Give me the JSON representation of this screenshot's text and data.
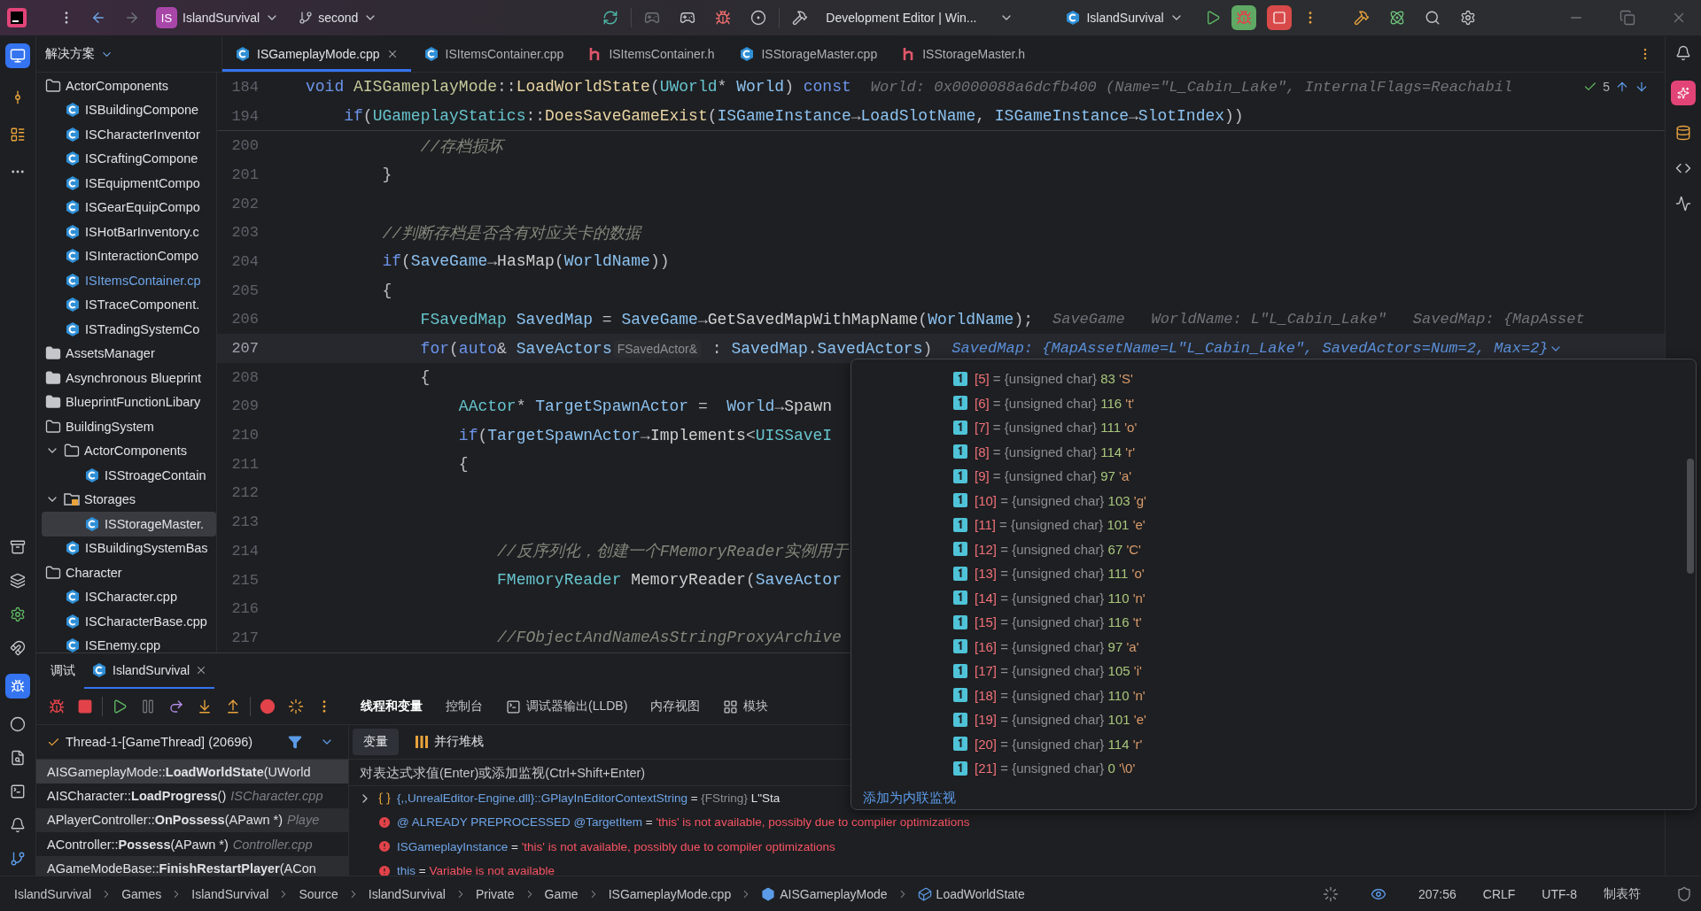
{
  "toolbar": {
    "project_badge": "IS",
    "project": "IslandSurvival",
    "branch": "second",
    "build_config": "Development Editor | Win...",
    "run_config": "IslandSurvival"
  },
  "explorer": {
    "title": "解决方案"
  },
  "editor_tabs": [
    {
      "label": "ISGameplayMode.cpp",
      "kind": "cpp",
      "selected": true
    },
    {
      "label": "ISItemsContainer.cpp",
      "kind": "cpp",
      "selected": false
    },
    {
      "label": "ISItemsContainer.h",
      "kind": "header",
      "selected": false
    },
    {
      "label": "ISStorageMaster.cpp",
      "kind": "cpp",
      "selected": false
    },
    {
      "label": "ISStorageMaster.h",
      "kind": "header",
      "selected": false
    }
  ],
  "tree": [
    {
      "label": "ActorComponents",
      "kind": "folder",
      "expanded": true,
      "selected": false,
      "children": [
        {
          "label": "ISBuildingCompone",
          "kind": "file",
          "selected": false,
          "modified": false
        },
        {
          "label": "ISCharacterInventor",
          "kind": "file",
          "selected": false,
          "modified": false
        },
        {
          "label": "ISCraftingCompone",
          "kind": "file",
          "selected": false,
          "modified": false
        },
        {
          "label": "ISEquipmentCompo",
          "kind": "file",
          "selected": false,
          "modified": false
        },
        {
          "label": "ISGearEquipCompo",
          "kind": "file",
          "selected": false,
          "modified": false
        },
        {
          "label": "ISHotBarInventory.c",
          "kind": "file",
          "selected": false,
          "modified": false
        },
        {
          "label": "ISInteractionCompo",
          "kind": "file",
          "selected": false,
          "modified": false
        },
        {
          "label": "ISItemsContainer.cp",
          "kind": "file",
          "selected": false,
          "modified": true
        },
        {
          "label": "ISTraceComponent.",
          "kind": "file",
          "selected": false,
          "modified": false
        },
        {
          "label": "ISTradingSystemCo",
          "kind": "file",
          "selected": false,
          "modified": false
        }
      ]
    },
    {
      "label": "AssetsManager",
      "kind": "folder",
      "expanded": false,
      "selected": false
    },
    {
      "label": "Asynchronous Blueprint",
      "kind": "folder",
      "expanded": false,
      "selected": false
    },
    {
      "label": "BlueprintFunctionLibary",
      "kind": "folder",
      "expanded": false,
      "selected": false
    },
    {
      "label": "BuildingSystem",
      "kind": "folder",
      "expanded": true,
      "selected": false,
      "children": [
        {
          "label": "ActorComponents",
          "kind": "folder",
          "expanded": true,
          "selected": false,
          "children": [
            {
              "label": "ISStroageContain",
              "kind": "file",
              "selected": false,
              "modified": false
            }
          ]
        },
        {
          "label": "Storages",
          "kind": "package",
          "expanded": true,
          "selected": false,
          "children": [
            {
              "label": "ISStorageMaster.",
              "kind": "file",
              "selected": true,
              "modified": false
            }
          ]
        },
        {
          "label": "ISBuildingSystemBas",
          "kind": "file",
          "selected": false,
          "modified": false
        }
      ]
    },
    {
      "label": "Character",
      "kind": "folder",
      "expanded": true,
      "selected": false,
      "children": [
        {
          "label": "ISCharacter.cpp",
          "kind": "file",
          "selected": false,
          "modified": false
        },
        {
          "label": "ISCharacterBase.cpp",
          "kind": "file",
          "selected": false,
          "modified": false
        },
        {
          "label": "ISEnemy.cpp",
          "kind": "file",
          "selected": false,
          "modified": false
        }
      ]
    }
  ],
  "editor": {
    "inspection_count": "5",
    "sticky_lines": [
      {
        "number": "184",
        "current": false,
        "tokens": [
          {
            "kind": "kw",
            "text": "void"
          },
          {
            "kind": "cls",
            "text": " AISGameplayMode"
          },
          {
            "kind": "p",
            "text": "::"
          },
          {
            "kind": "fn",
            "text": "LoadWorldState"
          },
          {
            "kind": "p",
            "text": "("
          },
          {
            "kind": "type",
            "text": "UWorld"
          },
          {
            "kind": "p",
            "text": "* "
          },
          {
            "kind": "var",
            "text": "World"
          },
          {
            "kind": "p",
            "text": ") "
          },
          {
            "kind": "kw",
            "text": "const"
          }
        ],
        "hints": [
          {
            "kind": "value",
            "text": "World: 0x0000088a6dcfb400 (Name=\"L_Cabin_Lake\", InternalFlags=Reachabil"
          }
        ]
      },
      {
        "number": "194",
        "current": false,
        "tokens": [
          {
            "kind": "kw",
            "text": "    if"
          },
          {
            "kind": "p",
            "text": "("
          },
          {
            "kind": "type",
            "text": "UGameplayStatics"
          },
          {
            "kind": "p",
            "text": "::"
          },
          {
            "kind": "fn",
            "text": "DoesSaveGameExist"
          },
          {
            "kind": "p",
            "text": "("
          },
          {
            "kind": "var",
            "text": "ISGameInstance"
          },
          {
            "kind": "p",
            "text": "→"
          },
          {
            "kind": "var",
            "text": "LoadSlotName"
          },
          {
            "kind": "p",
            "text": ", "
          },
          {
            "kind": "var",
            "text": "ISGameInstance"
          },
          {
            "kind": "p",
            "text": "→"
          },
          {
            "kind": "var",
            "text": "SlotIndex"
          },
          {
            "kind": "p",
            "text": "))"
          }
        ]
      }
    ],
    "lines": [
      {
        "number": "200",
        "current": false,
        "tokens": [
          {
            "kind": "cm",
            "text": "            //存档损坏"
          }
        ]
      },
      {
        "number": "201",
        "current": false,
        "tokens": [
          {
            "kind": "p",
            "text": "        }"
          }
        ]
      },
      {
        "number": "202",
        "current": false
      },
      {
        "number": "203",
        "current": false,
        "tokens": [
          {
            "kind": "cm",
            "text": "        //判断存档是否含有对应关卡的数据"
          }
        ]
      },
      {
        "number": "204",
        "current": false,
        "tokens": [
          {
            "kind": "kw",
            "text": "        if"
          },
          {
            "kind": "p",
            "text": "("
          },
          {
            "kind": "var",
            "text": "SaveGame"
          },
          {
            "kind": "p",
            "text": "→"
          },
          {
            "kind": "call",
            "text": "HasMap"
          },
          {
            "kind": "p",
            "text": "("
          },
          {
            "kind": "var",
            "text": "WorldName"
          },
          {
            "kind": "p",
            "text": "))"
          }
        ]
      },
      {
        "number": "205",
        "current": false,
        "tokens": [
          {
            "kind": "p",
            "text": "        {"
          }
        ]
      },
      {
        "number": "206",
        "current": false,
        "tokens": [
          {
            "kind": "type",
            "text": "            FSavedMap"
          },
          {
            "kind": "var",
            "text": " SavedMap"
          },
          {
            "kind": "p",
            "text": " = "
          },
          {
            "kind": "var",
            "text": "SaveGame"
          },
          {
            "kind": "p",
            "text": "→"
          },
          {
            "kind": "call",
            "text": "GetSavedMapWithMapName"
          },
          {
            "kind": "p",
            "text": "("
          },
          {
            "kind": "var",
            "text": "WorldName"
          },
          {
            "kind": "p",
            "text": ");"
          }
        ],
        "hints": [
          {
            "kind": "value",
            "text": "SaveGame"
          },
          {
            "kind": "value",
            "text": "WorldName: L\"L_Cabin_Lake\""
          },
          {
            "kind": "value",
            "text": "SavedMap: {MapAsset"
          }
        ]
      },
      {
        "number": "207",
        "current": true,
        "tokens": [
          {
            "kind": "kw",
            "text": "            for"
          },
          {
            "kind": "p",
            "text": "("
          },
          {
            "kind": "kw",
            "text": "auto"
          },
          {
            "kind": "p",
            "text": "& "
          },
          {
            "kind": "var",
            "text": "SaveActors"
          },
          {
            "kind": "inlay",
            "text": "FSavedActor&"
          },
          {
            "kind": "p",
            "text": " : "
          },
          {
            "kind": "var",
            "text": "SavedMap"
          },
          {
            "kind": "p",
            "text": "."
          },
          {
            "kind": "var",
            "text": "SavedActors"
          },
          {
            "kind": "p",
            "text": ")"
          }
        ],
        "hints": [
          {
            "kind": "active",
            "text": "SavedMap: {MapAssetName=L\"L_Cabin_Lake\", SavedActors=Num=2, Max=2}"
          }
        ]
      },
      {
        "number": "208",
        "current": false,
        "tokens": [
          {
            "kind": "p",
            "text": "            {"
          }
        ]
      },
      {
        "number": "209",
        "current": false,
        "tokens": [
          {
            "kind": "type",
            "text": "                AActor"
          },
          {
            "kind": "p",
            "text": "* "
          },
          {
            "kind": "var",
            "text": "TargetSpawnActor"
          },
          {
            "kind": "p",
            "text": " =  "
          },
          {
            "kind": "var",
            "text": "World"
          },
          {
            "kind": "p",
            "text": "→"
          },
          {
            "kind": "call",
            "text": "Spawn"
          }
        ]
      },
      {
        "number": "210",
        "current": false,
        "tokens": [
          {
            "kind": "kw",
            "text": "                if"
          },
          {
            "kind": "p",
            "text": "("
          },
          {
            "kind": "var",
            "text": "TargetSpawnActor"
          },
          {
            "kind": "p",
            "text": "→"
          },
          {
            "kind": "call",
            "text": "Implements"
          },
          {
            "kind": "p",
            "text": "<"
          },
          {
            "kind": "type",
            "text": "UISSaveI"
          }
        ]
      },
      {
        "number": "211",
        "current": false,
        "tokens": [
          {
            "kind": "p",
            "text": "                {"
          }
        ]
      },
      {
        "number": "212",
        "current": false
      },
      {
        "number": "213",
        "current": false
      },
      {
        "number": "214",
        "current": false,
        "tokens": [
          {
            "kind": "cm",
            "text": "                    //反序列化，创建一个FMemoryReader实例用于"
          }
        ]
      },
      {
        "number": "215",
        "current": false,
        "tokens": [
          {
            "kind": "type",
            "text": "                    FMemoryReader"
          },
          {
            "kind": "call",
            "text": " MemoryReader"
          },
          {
            "kind": "p",
            "text": "("
          },
          {
            "kind": "var",
            "text": "SaveActor"
          }
        ]
      },
      {
        "number": "216",
        "current": false
      },
      {
        "number": "217",
        "current": false,
        "tokens": [
          {
            "kind": "cm",
            "text": "                    //FObjectAndNameAsStringProxyArchive"
          }
        ]
      }
    ]
  },
  "popup": {
    "rows": [
      {
        "index": "[5]",
        "type": "= {unsigned char}",
        "value": "83",
        "char": "'S'"
      },
      {
        "index": "[6]",
        "type": "= {unsigned char}",
        "value": "116",
        "char": "'t'"
      },
      {
        "index": "[7]",
        "type": "= {unsigned char}",
        "value": "111",
        "char": "'o'"
      },
      {
        "index": "[8]",
        "type": "= {unsigned char}",
        "value": "114",
        "char": "'r'"
      },
      {
        "index": "[9]",
        "type": "= {unsigned char}",
        "value": "97",
        "char": "'a'"
      },
      {
        "index": "[10]",
        "type": "= {unsigned char}",
        "value": "103",
        "char": "'g'"
      },
      {
        "index": "[11]",
        "type": "= {unsigned char}",
        "value": "101",
        "char": "'e'"
      },
      {
        "index": "[12]",
        "type": "= {unsigned char}",
        "value": "67",
        "char": "'C'"
      },
      {
        "index": "[13]",
        "type": "= {unsigned char}",
        "value": "111",
        "char": "'o'"
      },
      {
        "index": "[14]",
        "type": "= {unsigned char}",
        "value": "110",
        "char": "'n'"
      },
      {
        "index": "[15]",
        "type": "= {unsigned char}",
        "value": "116",
        "char": "'t'"
      },
      {
        "index": "[16]",
        "type": "= {unsigned char}",
        "value": "97",
        "char": "'a'"
      },
      {
        "index": "[17]",
        "type": "= {unsigned char}",
        "value": "105",
        "char": "'i'"
      },
      {
        "index": "[18]",
        "type": "= {unsigned char}",
        "value": "110",
        "char": "'n'"
      },
      {
        "index": "[19]",
        "type": "= {unsigned char}",
        "value": "101",
        "char": "'e'"
      },
      {
        "index": "[20]",
        "type": "= {unsigned char}",
        "value": "114",
        "char": "'r'"
      },
      {
        "index": "[21]",
        "type": "= {unsigned char}",
        "value": "0",
        "char": "'\\0'"
      }
    ],
    "link": "添加为内联监视"
  },
  "debug": {
    "title": "调试",
    "session": "IslandSurvival",
    "tabs": [
      {
        "label": "线程和变量",
        "kind": "plain",
        "selected": true
      },
      {
        "label": "控制台",
        "kind": "plain",
        "selected": false
      },
      {
        "label": "调试器输出(LLDB)",
        "kind": "terminal",
        "selected": false
      },
      {
        "label": "内存视图",
        "kind": "plain",
        "selected": false
      },
      {
        "label": "模块",
        "kind": "modules",
        "selected": false
      }
    ],
    "thread": "Thread-1-[GameThread] (20696)",
    "frames": [
      {
        "text": "AISGameplayMode::**LoadWorldState**(UWorld",
        "selected": true,
        "external": false
      },
      {
        "text": "AISCharacter::**LoadProgress**()",
        "file": "ISCharacter.cpp",
        "selected": false,
        "external": false
      },
      {
        "text": "APlayerController::**OnPossess**(APawn *)",
        "file": "Playe",
        "selected": false,
        "external": true
      },
      {
        "text": "AController::**Possess**(APawn *)",
        "file": "Controller.cpp",
        "selected": false,
        "external": false
      },
      {
        "text": "AGameModeBase::**FinishRestartPlayer**(ACon",
        "selected": false,
        "external": true
      }
    ],
    "subtabs": [
      {
        "label": "变量",
        "kind": "plain",
        "selected": true
      },
      {
        "label": "并行堆栈",
        "kind": "stacks",
        "selected": false
      }
    ],
    "eval_placeholder": "对表达式求值(Enter)或添加监视(Ctrl+Shift+Enter)",
    "variables": [
      {
        "kind": "expandable",
        "name": "{,,UnrealEditor-Engine.dll}::GPlayInEditorContextString",
        "op": "=",
        "type": "{FString}",
        "value": "L\"Sta"
      },
      {
        "kind": "error",
        "name": "@ ALREADY PREPROCESSED @TargetItem",
        "op": "=",
        "value": "'this' is not available, possibly due to compiler optimizations"
      },
      {
        "kind": "error",
        "name": "ISGameplayInstance",
        "op": "=",
        "value": "'this' is not available, possibly due to compiler optimizations"
      },
      {
        "kind": "error",
        "name": "this",
        "op": "=",
        "value": "Variable is not available"
      }
    ]
  },
  "status_bar": {
    "breadcrumbs": [
      {
        "label": "IslandSurvival",
        "kind": "plain"
      },
      {
        "label": "Games",
        "kind": "plain"
      },
      {
        "label": "IslandSurvival",
        "kind": "plain"
      },
      {
        "label": "Source",
        "kind": "plain"
      },
      {
        "label": "IslandSurvival",
        "kind": "plain"
      },
      {
        "label": "Private",
        "kind": "plain"
      },
      {
        "label": "Game",
        "kind": "plain"
      },
      {
        "label": "ISGameplayMode.cpp",
        "kind": "plain"
      },
      {
        "label": "AISGameplayMode",
        "kind": "class"
      },
      {
        "label": "LoadWorldState",
        "kind": "method"
      }
    ],
    "position": "207:56",
    "line_ending": "CRLF",
    "encoding": "UTF-8",
    "indent": "制表符"
  }
}
